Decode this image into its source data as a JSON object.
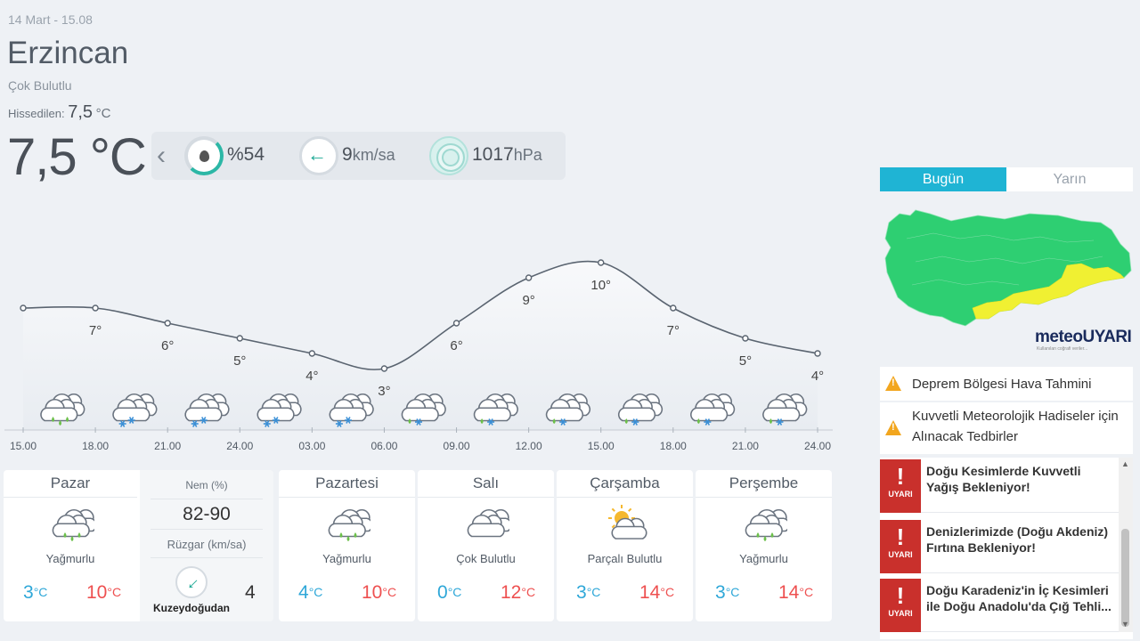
{
  "header": {
    "date": "14 Mart - 15.08",
    "city": "Erzincan",
    "condition": "Çok Bulutlu",
    "feels_label": "Hissedilen:",
    "feels_value": "7,5",
    "feels_unit": "°C",
    "temperature": "7,5 °C"
  },
  "info": {
    "humidity": "%54",
    "wind_value": "9",
    "wind_unit": "km/sa",
    "pressure_value": "1017",
    "pressure_unit": "hPa"
  },
  "chart_data": {
    "type": "line",
    "x": [
      "15.00",
      "18.00",
      "21.00",
      "24.00",
      "03.00",
      "06.00",
      "09.00",
      "12.00",
      "15.00",
      "18.00",
      "21.00",
      "24.00"
    ],
    "values": [
      7,
      7,
      6,
      5,
      4,
      3,
      6,
      9,
      10,
      7,
      5,
      4
    ],
    "labels": [
      "7°",
      "6°",
      "5°",
      "4°",
      "3°",
      "6°",
      "9°",
      "10°",
      "7°",
      "5°",
      "4°"
    ],
    "icons": [
      "rain",
      "snow",
      "snow",
      "snow",
      "snow",
      "rain-snow",
      "rain-snow",
      "rain-snow",
      "rain-snow",
      "rain-snow",
      "rain-snow"
    ]
  },
  "days": [
    {
      "name": "Pazar",
      "cond": "Yağmurlu",
      "lo": "3",
      "hi": "10",
      "icon": "rain"
    },
    {
      "name": "Pazartesi",
      "cond": "Yağmurlu",
      "lo": "4",
      "hi": "10",
      "icon": "rain"
    },
    {
      "name": "Salı",
      "cond": "Çok Bulutlu",
      "lo": "0",
      "hi": "12",
      "icon": "cloudy"
    },
    {
      "name": "Çarşamba",
      "cond": "Parçalı Bulutlu",
      "lo": "3",
      "hi": "14",
      "icon": "partly-cloudy"
    },
    {
      "name": "Perşembe",
      "cond": "Yağmurlu",
      "lo": "3",
      "hi": "14",
      "icon": "rain"
    }
  ],
  "unit_c": "°C",
  "detail": {
    "humidity_label": "Nem (%)",
    "humidity_value": "82-90",
    "wind_label": "Rüzgar (km/sa)",
    "wind_value": "4",
    "wind_dir": "Kuzeydoğudan"
  },
  "tabs": {
    "today": "Bugün",
    "tomorrow": "Yarın"
  },
  "logo": {
    "a": "meteo",
    "b": "UYARI",
    "sub": "Kullanılan coğrafi veriler..."
  },
  "alerts": [
    {
      "text": "Deprem Bölgesi Hava Tahmini"
    },
    {
      "text": "Kuvvetli Meteorolojik Hadiseler için Alınacak Tedbirler"
    }
  ],
  "warnings": {
    "badge_mark": "!",
    "badge_label": "UYARI",
    "items": [
      {
        "title": "Doğu Kesimlerde Kuvvetli\nYağış Bekleniyor!"
      },
      {
        "title": "Denizlerimizde (Doğu Akdeniz)\nFırtına Bekleniyor!"
      },
      {
        "title": "Doğu Karadeniz'in İç Kesimleri\nile Doğu Anadolu'da Çığ Tehli..."
      }
    ]
  },
  "colors": {
    "accent": "#1fb4d4",
    "lo": "#2ea7d8",
    "hi": "#ee5050",
    "warn": "#c9302c",
    "map_green": "#2ecf72",
    "map_yellow": "#f0f032"
  }
}
